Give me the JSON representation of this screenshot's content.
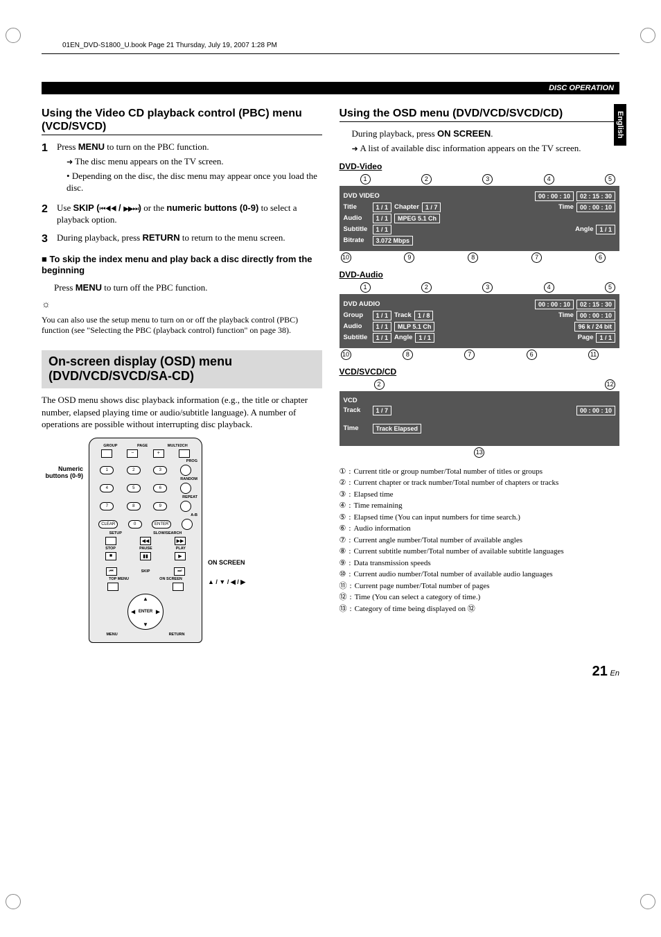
{
  "header_line": "01EN_DVD-S1800_U.book  Page 21  Thursday, July 19, 2007  1:28 PM",
  "black_bar": "DISC OPERATION",
  "lang_tab": "English",
  "left": {
    "h1": "Using the Video CD playback control (PBC) menu (VCD/SVCD)",
    "step1": "Press ",
    "step1b": "MENU",
    "step1c": " to turn on the PBC function.",
    "step1_sub1": "The disc menu appears on the TV screen.",
    "step1_sub2": "Depending on the disc, the disc menu may appear once you load the disc.",
    "step2a": "Use ",
    "step2b": "SKIP (",
    "step2c": ")",
    "step2d": " or the ",
    "step2e": "numeric buttons (0-9)",
    "step2f": " to select a playback option.",
    "step3a": "During playback, press ",
    "step3b": "RETURN",
    "step3c": " to return to the menu screen.",
    "sq_hd": "To skip the index menu and play back a disc directly from the beginning",
    "sq_body_a": "Press ",
    "sq_body_b": "MENU",
    "sq_body_c": " to turn off the PBC function.",
    "tip": "You can also use the setup menu to turn on or off the playback control (PBC) function (see \"Selecting the PBC (playback control) function\" on page 38).",
    "section_title": "On-screen display (OSD) menu (DVD/VCD/SVCD/SA-CD)",
    "section_para": "The OSD menu shows disc playback information (e.g., the title or chapter number, elapsed playing time or audio/subtitle language). A number of operations are possible without interrupting disc playback.",
    "remote_label_left": "Numeric buttons (0-9)",
    "remote_label_onscreen": "ON SCREEN",
    "remote_label_arrows": "▲ / ▼ / ◀ / ▶",
    "remote": {
      "top": [
        "GROUP",
        "PAGE",
        "MULTI/2CH"
      ],
      "minus": "−",
      "plus": "+",
      "prog": "PROG",
      "random": "RANDOM",
      "repeat": "REPEAT",
      "ab": "A-B",
      "clear": "CLEAR",
      "enter_small": "ENTER",
      "setup": "SETUP",
      "slow": "SLOW/SEARCH",
      "stop": "STOP",
      "pause": "PAUSE",
      "play": "PLAY",
      "skip": "SKIP",
      "topmenu": "TOP MENU",
      "onscreen": "ON SCREEN",
      "enter": "ENTER",
      "menu": "MENU",
      "return": "RETURN"
    }
  },
  "right": {
    "h1": "Using the OSD menu (DVD/VCD/SVCD/CD)",
    "intro_a": "During playback, press ",
    "intro_b": "ON SCREEN",
    "intro_c": ".",
    "intro_sub": "A list of available disc information appears on the TV screen.",
    "dvdvideo_h": "DVD-Video",
    "dvdvideo": {
      "type": "DVD VIDEO",
      "elapsed": "00 : 00 : 10",
      "remain": "02 : 15 : 30",
      "title_l": "Title",
      "title_v": "1 / 1",
      "chapter_l": "Chapter",
      "chapter_v": "1 / 7",
      "time_l": "Time",
      "time_v": "00 : 00 : 10",
      "audio_l": "Audio",
      "audio_v": "1 / 1",
      "audio_fmt": "MPEG  5.1 Ch",
      "sub_l": "Subtitle",
      "sub_v": "1 / 1",
      "angle_l": "Angle",
      "angle_v": "1 / 1",
      "bitrate_l": "Bitrate",
      "bitrate_v": "3.072 Mbps"
    },
    "dvdaudio_h": "DVD-Audio",
    "dvdaudio": {
      "type": "DVD AUDIO",
      "elapsed": "00 : 00 : 10",
      "remain": "02 : 15 : 30",
      "group_l": "Group",
      "group_v": "1 / 1",
      "track_l": "Track",
      "track_v": "1 / 8",
      "time_l": "Time",
      "time_v": "00 : 00 : 10",
      "audio_l": "Audio",
      "audio_v": "1 / 1",
      "audio_fmt": "MLP  5.1 Ch",
      "audio_res": "96 k / 24 bit",
      "sub_l": "Subtitle",
      "sub_v": "1 / 1",
      "angle_l": "Angle",
      "angle_v": "1 / 1",
      "page_l": "Page",
      "page_v": "1 / 1"
    },
    "vcd_h": "VCD/SVCD/CD",
    "vcd": {
      "type": "VCD",
      "track_l": "Track",
      "track_v": "1 / 7",
      "time_v": "00 : 00 : 10",
      "time_l": "Time",
      "cat": "Track Elapsed"
    },
    "legend": [
      "Current title or group number/Total number of titles or groups",
      "Current chapter or track number/Total number of chapters or tracks",
      "Elapsed time",
      "Time remaining",
      "Elapsed time (You can input numbers for time search.)",
      "Audio information",
      "Current angle number/Total number of available angles",
      "Current subtitle number/Total number of available subtitle languages",
      "Data transmission speeds",
      "Current audio number/Total number of available audio languages",
      "Current page number/Total number of pages",
      "Time (You can select a category of time.)",
      "Category of time being displayed on ⑫"
    ],
    "legend_nums": [
      "①",
      "②",
      "③",
      "④",
      "⑤",
      "⑥",
      "⑦",
      "⑧",
      "⑨",
      "⑩",
      "⑪",
      "⑫",
      "⑬"
    ]
  },
  "page_num": "21",
  "page_lang": "En"
}
